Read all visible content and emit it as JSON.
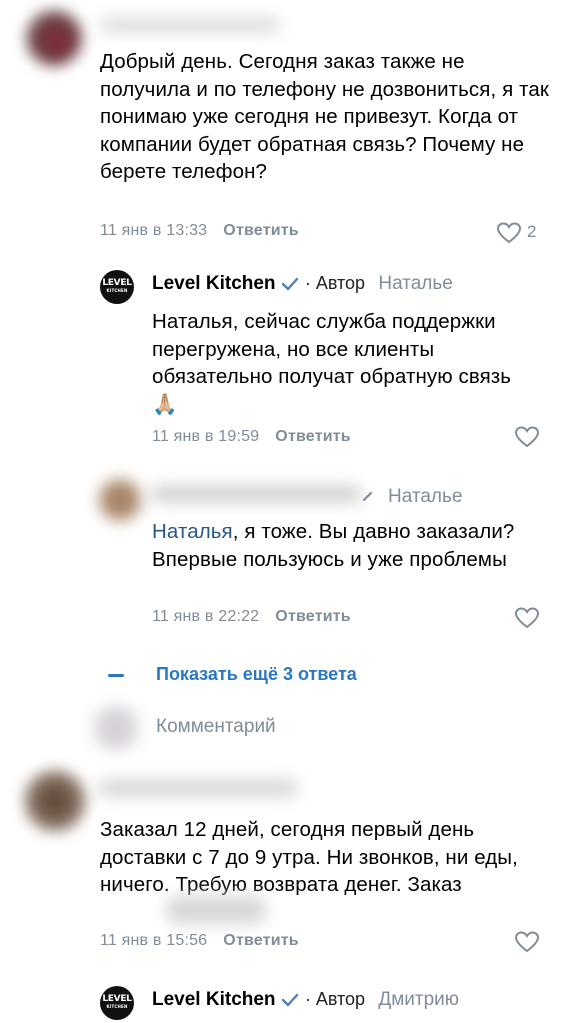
{
  "comments": [
    {
      "text": "Добрый день. Сегодня заказ также не получила и по телефону не дозвониться, я так понимаю уже сегодня не привезут. Когда от компании будет обратная связь? Почему не берете телефон?",
      "time": "11 янв в 13:33",
      "reply_label": "Ответить",
      "likes": "2"
    },
    {
      "author": "Level Kitchen",
      "badge": "· Автор",
      "reply_to": "Натальe",
      "text": "Наталья, сейчас служба поддержки перегружена, но все клиенты обязательно получат обратную связь 🙏🏼",
      "time": "11 янв в 19:59",
      "reply_label": "Ответить"
    },
    {
      "reply_to": "Натальe",
      "mention": "Наталья",
      "text": ", я тоже. Вы давно заказали? Впервые пользуюсь и уже проблемы",
      "time": "11 янв в 22:22",
      "reply_label": "Ответить"
    },
    {
      "text": "Заказал 12 дней, сегодня первый день доставки с 7 до 9 утра. Ни звонков, ни еды, ничего. Требую возврата денег. Заказ",
      "time": "11 янв в 15:56",
      "reply_label": "Ответить"
    },
    {
      "author": "Level Kitchen",
      "badge": "· Автор",
      "reply_to": "Дмитрию"
    }
  ],
  "show_more": "Показать ещё 3 ответа",
  "comment_input": {
    "placeholder": "Комментарий"
  },
  "logo": {
    "line1": "LEVEL",
    "line2": "KITCHEN"
  },
  "colors": {
    "meta": "#818c99",
    "link": "#2a78c2",
    "verified": "#5181b8"
  },
  "icons": {
    "like": "heart-outline-icon",
    "verified": "verified-check-icon",
    "pencil": "pencil-icon"
  }
}
